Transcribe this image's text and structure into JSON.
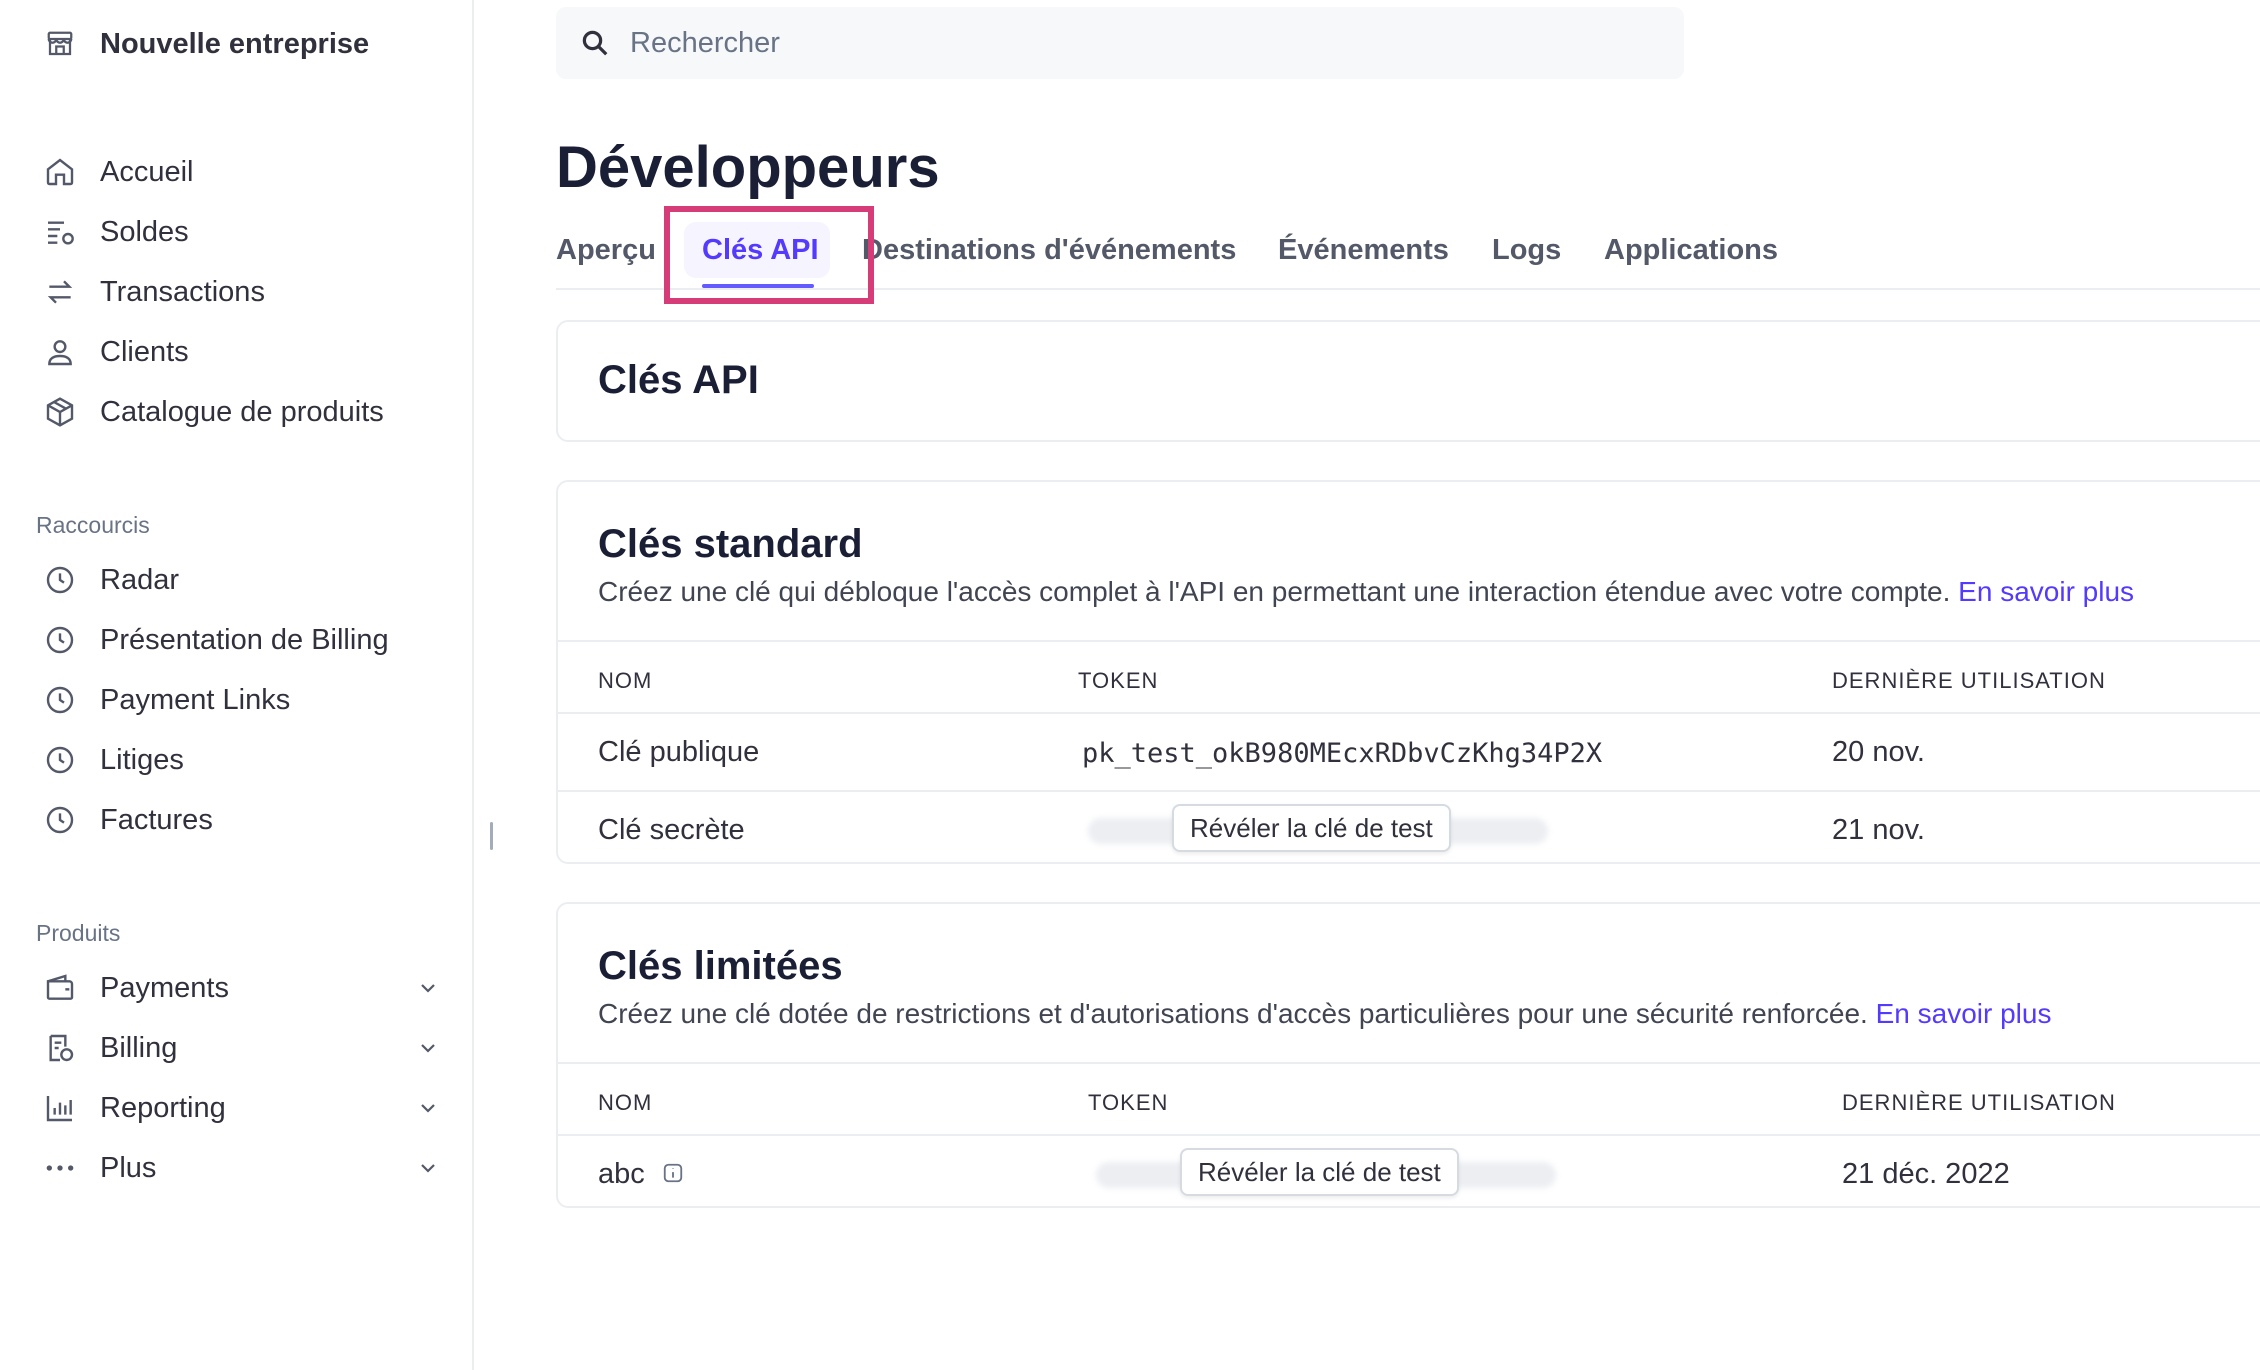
{
  "sidebar": {
    "brand": "Nouvelle entreprise",
    "main_items": [
      {
        "label": "Accueil",
        "icon": "home-icon"
      },
      {
        "label": "Soldes",
        "icon": "balance-icon"
      },
      {
        "label": "Transactions",
        "icon": "arrows-icon"
      },
      {
        "label": "Clients",
        "icon": "person-icon"
      },
      {
        "label": "Catalogue de produits",
        "icon": "box-icon"
      }
    ],
    "shortcuts_label": "Raccourcis",
    "shortcuts": [
      {
        "label": "Radar",
        "icon": "clock-icon"
      },
      {
        "label": "Présentation de Billing",
        "icon": "clock-icon"
      },
      {
        "label": "Payment Links",
        "icon": "clock-icon"
      },
      {
        "label": "Litiges",
        "icon": "clock-icon"
      },
      {
        "label": "Factures",
        "icon": "clock-icon"
      }
    ],
    "products_label": "Produits",
    "products": [
      {
        "label": "Payments",
        "icon": "wallet-icon"
      },
      {
        "label": "Billing",
        "icon": "invoice-icon"
      },
      {
        "label": "Reporting",
        "icon": "bar-chart-icon"
      },
      {
        "label": "Plus",
        "icon": "more-dots-icon"
      }
    ]
  },
  "search": {
    "placeholder": "Rechercher"
  },
  "page": {
    "title": "Développeurs"
  },
  "tabs": [
    {
      "label": "Aperçu"
    },
    {
      "label": "Clés API"
    },
    {
      "label": "Destinations d'événements"
    },
    {
      "label": "Événements"
    },
    {
      "label": "Logs"
    },
    {
      "label": "Applications"
    }
  ],
  "api_card": {
    "title": "Clés API"
  },
  "standard": {
    "title": "Clés standard",
    "description": "Créez une clé qui débloque l'accès complet à l'API en permettant une interaction étendue avec votre compte.",
    "link": "En savoir plus",
    "headers": {
      "name": "NOM",
      "token": "TOKEN",
      "last_used": "DERNIÈRE UTILISATION"
    },
    "rows": [
      {
        "name": "Clé publique",
        "token": "pk_test_okB980MEcxRDbvCzKhg34P2X",
        "last_used": "20 nov."
      },
      {
        "name": "Clé secrète",
        "reveal": "Révéler la clé de test",
        "last_used": "21 nov."
      }
    ]
  },
  "restricted": {
    "title": "Clés limitées",
    "description": "Créez une clé dotée de restrictions et d'autorisations d'accès particulières pour une sécurité renforcée.",
    "link": "En savoir plus",
    "headers": {
      "name": "NOM",
      "token": "TOKEN",
      "last_used": "DERNIÈRE UTILISATION"
    },
    "rows": [
      {
        "name": "abc",
        "reveal": "Révéler la clé de test",
        "last_used": "21 déc. 2022"
      }
    ]
  },
  "colors": {
    "accent": "#533afd",
    "highlight": "#d63d78",
    "text": "#30313d",
    "border": "#ebeef1"
  }
}
